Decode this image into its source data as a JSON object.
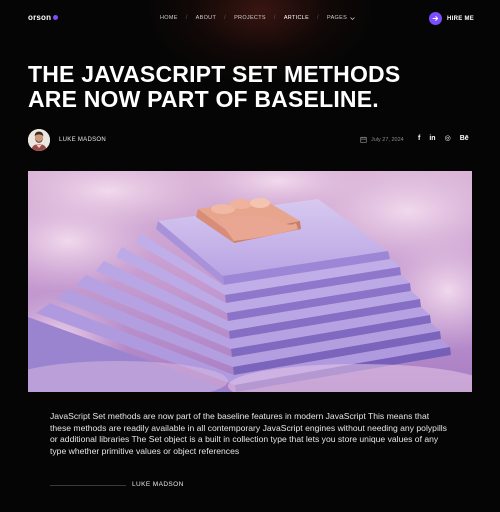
{
  "brand": {
    "name": "orson",
    "accent": "#7b4dff"
  },
  "nav": {
    "items": [
      {
        "label": "HOME"
      },
      {
        "label": "ABOUT"
      },
      {
        "label": "PROJECTS"
      },
      {
        "label": "ARTICLE"
      },
      {
        "label": "PAGES"
      }
    ],
    "active": "ARTICLE",
    "separator": "/"
  },
  "cta": {
    "label": "HIRE ME",
    "icon": "arrow-right-icon"
  },
  "article": {
    "title_line1": "THE JAVASCRIPT SET METHODS",
    "title_line2": "ARE NOW PART OF BASELINE.",
    "author": "LUKE MADSON",
    "date": "July 27, 2024",
    "date_icon": "calendar-icon",
    "socials": [
      {
        "name": "facebook-icon",
        "glyph": "f"
      },
      {
        "name": "linkedin-icon",
        "glyph": "in"
      },
      {
        "name": "instagram-icon",
        "glyph": "◎"
      },
      {
        "name": "behance-icon",
        "glyph": "Bē"
      }
    ],
    "hero_image": "pink-bed-on-stepped-pyramid-in-clouds",
    "body": "JavaScript Set methods are now part of the baseline features in modern JavaScript This means that these methods are readily available in all contemporary JavaScript engines without needing any polypills or additional libraries The Set object is a built in collection type that lets you store unique values of any type whether primitive values or object references",
    "quote_author": "LUKE MADSON"
  }
}
